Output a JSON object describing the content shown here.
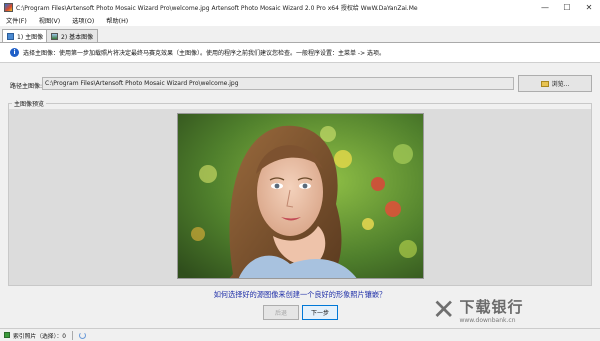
{
  "window": {
    "title": "C:\\Program Files\\Artensoft Photo Mosaic Wizard Pro\\welcome.jpg Artensoft Photo Mosaic Wizard 2.0 Pro x64  授权给 WwW.DaYanZai.Me",
    "minimize": "—",
    "maximize": "☐",
    "close": "✕"
  },
  "menu": [
    "文件(F)",
    "视图(V)",
    "选项(O)",
    "帮助(H)"
  ],
  "tabs": [
    {
      "label": "1) 主图像",
      "active": true
    },
    {
      "label": "2) 基本图像",
      "active": false
    }
  ],
  "info": {
    "text": "选择主图像：使用第一步加载照片将决定最终马赛克效果（主图像）。使用的程序之前我们建议您检查。一般程序设置：主菜单 -> 选项。"
  },
  "path": {
    "label": "路径主图像:",
    "value": "C:\\Program Files\\Artensoft Photo Mosaic Wizard Pro\\welcome.jpg",
    "browse_label": "浏览..."
  },
  "preview": {
    "group_title": "主图像预览"
  },
  "help_link": "如何选择好的源图像来创建一个良好的形象照片镶嵌？",
  "buttons": {
    "prev": "后退",
    "next": "下一步"
  },
  "watermark": {
    "cn": "下载银行",
    "url": "www.downbank.cn"
  },
  "status": {
    "text": "索引照片（选择）：0"
  }
}
